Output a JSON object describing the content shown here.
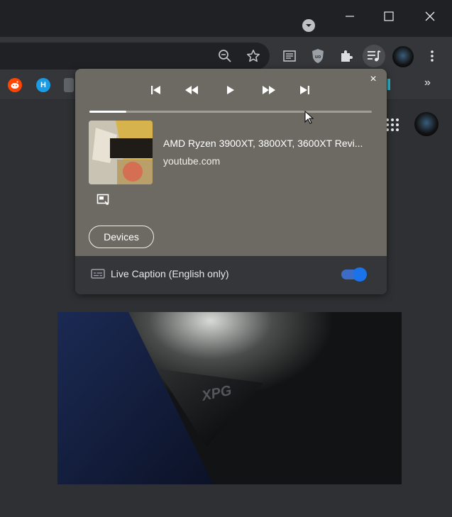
{
  "window": {
    "minimize_icon": "minimize-icon",
    "maximize_icon": "maximize-icon",
    "close_icon": "close-icon"
  },
  "toolbar": {
    "icons": [
      "zoom-out-icon",
      "star-icon",
      "reading-list-icon",
      "ublock-icon",
      "extensions-icon",
      "media-controls-icon",
      "avatar",
      "more-vert-icon"
    ]
  },
  "bookmarks": {
    "items": [
      {
        "icon": "reddit-icon",
        "label": "",
        "color": "#ff4500"
      },
      {
        "icon": "h-icon",
        "label": "H",
        "color": "#1a9be6"
      },
      {
        "icon": "bookmark-icon",
        "label": "",
        "color": "#5f6368"
      }
    ],
    "overflow_label": "»"
  },
  "media_dialog": {
    "close_label": "×",
    "progress": 0.13,
    "track": {
      "title": "AMD Ryzen 3900XT, 3800XT, 3600XT Revi...",
      "source": "youtube.com"
    },
    "devices_label": "Devices",
    "live_caption": {
      "label": "Live Caption (English only)",
      "enabled": true
    }
  },
  "colors": {
    "dialog_bg": "#6d6a63",
    "accent": "#1a73e8",
    "frame": "#202124",
    "toolbar": "#35363a"
  },
  "video": {
    "logo_text": "XPG"
  }
}
